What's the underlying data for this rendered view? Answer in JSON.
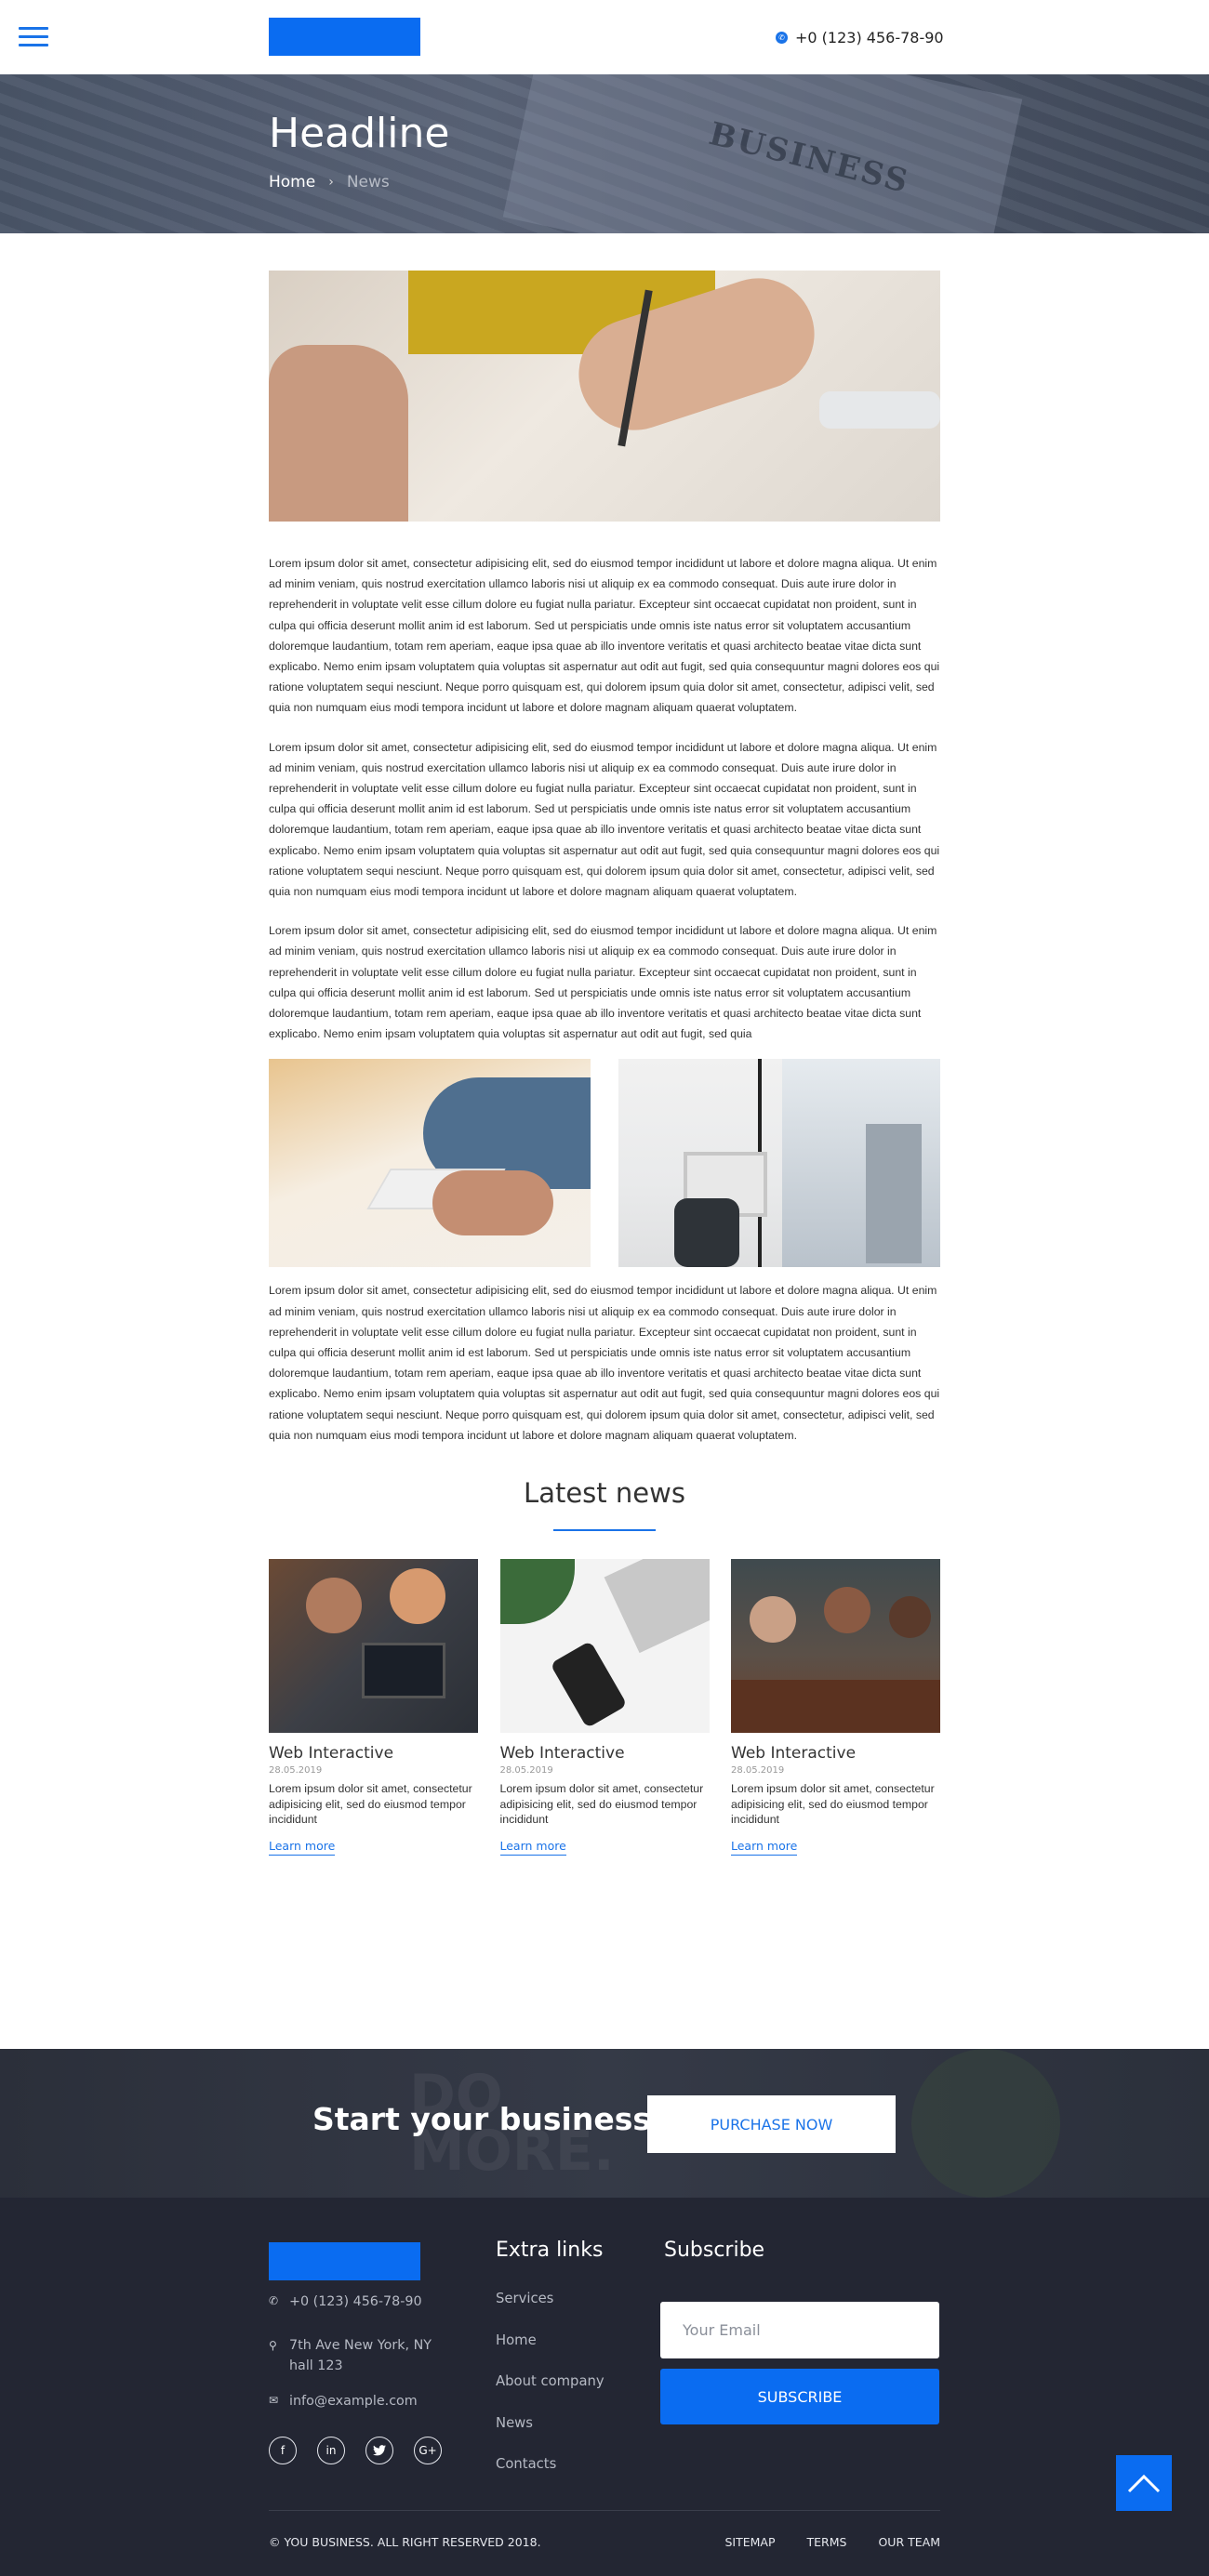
{
  "header": {
    "phone": "+0 (123) 456-78-90"
  },
  "hero": {
    "title": "Headline",
    "breadcrumb": {
      "home": "Home",
      "separator": "›",
      "current": "News"
    }
  },
  "article": {
    "paragraphs": [
      "Lorem ipsum dolor sit amet, consectetur adipisicing elit, sed do eiusmod tempor incididunt ut labore et dolore magna aliqua. Ut enim ad minim veniam, quis nostrud exercitation ullamco laboris nisi ut aliquip ex ea commodo consequat. Duis aute irure dolor in reprehenderit in voluptate velit esse cillum dolore eu fugiat nulla pariatur. Excepteur sint occaecat cupidatat non proident, sunt in culpa qui officia deserunt mollit anim id est laborum. Sed ut perspiciatis unde omnis iste natus error sit voluptatem accusantium doloremque laudantium, totam rem aperiam, eaque ipsa quae ab illo inventore veritatis et quasi architecto beatae vitae dicta sunt explicabo. Nemo enim ipsam voluptatem quia voluptas sit aspernatur aut odit aut fugit, sed quia consequuntur magni dolores eos qui ratione voluptatem sequi nesciunt. Neque porro quisquam est, qui dolorem ipsum quia dolor sit amet, consectetur, adipisci velit, sed quia non numquam eius modi tempora incidunt ut labore et dolore magnam aliquam quaerat voluptatem.",
      "Lorem ipsum dolor sit amet, consectetur adipisicing elit, sed do eiusmod tempor incididunt ut labore et dolore magna aliqua. Ut enim ad minim veniam, quis nostrud exercitation ullamco laboris nisi ut aliquip ex ea commodo consequat. Duis aute irure dolor in reprehenderit in voluptate velit esse cillum dolore eu fugiat nulla pariatur. Excepteur sint occaecat cupidatat non proident, sunt in culpa qui officia deserunt mollit anim id est laborum. Sed ut perspiciatis unde omnis iste natus error sit voluptatem accusantium doloremque laudantium, totam rem aperiam, eaque ipsa quae ab illo inventore veritatis et quasi architecto beatae vitae dicta sunt explicabo. Nemo enim ipsam voluptatem quia voluptas sit aspernatur aut odit aut fugit, sed quia consequuntur magni dolores eos qui ratione voluptatem sequi nesciunt. Neque porro quisquam est, qui dolorem ipsum quia dolor sit amet, consectetur, adipisci velit, sed quia non numquam eius modi tempora incidunt ut labore et dolore magnam aliquam quaerat voluptatem.",
      "Lorem ipsum dolor sit amet, consectetur adipisicing elit, sed do eiusmod tempor incididunt ut labore et dolore magna aliqua. Ut enim ad minim veniam, quis nostrud exercitation ullamco laboris nisi ut aliquip ex ea commodo consequat. Duis aute irure dolor in reprehenderit in voluptate velit esse cillum dolore eu fugiat nulla pariatur. Excepteur sint occaecat cupidatat non proident, sunt in culpa qui officia deserunt mollit anim id est laborum. Sed ut perspiciatis unde omnis iste natus error sit voluptatem accusantium doloremque laudantium, totam rem aperiam, eaque ipsa quae ab illo inventore veritatis et quasi architecto beatae vitae dicta sunt explicabo. Nemo enim ipsam voluptatem quia voluptas sit aspernatur aut odit aut fugit, sed quia",
      "Lorem ipsum dolor sit amet, consectetur adipisicing elit, sed do eiusmod tempor incididunt ut labore et dolore magna aliqua. Ut enim ad minim veniam, quis nostrud exercitation ullamco laboris nisi ut aliquip ex ea commodo consequat. Duis aute irure dolor in reprehenderit in voluptate velit esse cillum dolore eu fugiat nulla pariatur. Excepteur sint occaecat cupidatat non proident, sunt in culpa qui officia deserunt mollit anim id est laborum. Sed ut perspiciatis unde omnis iste natus error sit voluptatem accusantium doloremque laudantium, totam rem aperiam, eaque ipsa quae ab illo inventore veritatis et quasi architecto beatae vitae dicta sunt explicabo. Nemo enim ipsam voluptatem quia voluptas sit aspernatur aut odit aut fugit, sed quia consequuntur magni dolores eos qui ratione voluptatem sequi nesciunt. Neque porro quisquam est, qui dolorem ipsum quia dolor sit amet, consectetur, adipisci velit, sed quia non numquam eius modi tempora incidunt ut labore et dolore magnam aliquam quaerat voluptatem."
    ]
  },
  "latest_news": {
    "title": "Latest news",
    "items": [
      {
        "title": "Web Interactive",
        "date": "28.05.2019",
        "text": "Lorem ipsum dolor sit amet, consectetur adipisicing elit, sed do eiusmod tempor incididunt",
        "link": "Learn more"
      },
      {
        "title": "Web Interactive",
        "date": "28.05.2019",
        "text": "Lorem ipsum dolor sit amet, consectetur adipisicing elit, sed do eiusmod tempor incididunt",
        "link": "Learn more"
      },
      {
        "title": "Web Interactive",
        "date": "28.05.2019",
        "text": "Lorem ipsum dolor sit amet, consectetur adipisicing elit, sed do eiusmod tempor incididunt",
        "link": "Learn more"
      }
    ]
  },
  "cta": {
    "title": "Start your business",
    "button": "PURCHASE NOW"
  },
  "footer": {
    "phone": "+0 (123) 456-78-90",
    "address": "7th Ave New York, NY hall 123",
    "email": "info@example.com",
    "socials": [
      "facebook-icon",
      "linkedin-icon",
      "twitter-icon",
      "google-plus-icon"
    ],
    "extra_links_title": "Extra links",
    "extra_links": [
      "Services",
      "Home",
      "About company",
      "News",
      "Contacts"
    ],
    "subscribe_title": "Subscribe",
    "email_placeholder": "Your Email",
    "subscribe_button": "SUBSCRIBE",
    "copyright": "© YOU BUSINESS. ALL RIGHT RESERVED 2018.",
    "bottom_links": [
      "SITEMAP",
      "TERMS",
      "OUR TEAM"
    ]
  },
  "colors": {
    "accent": "#0a6cf1",
    "footer_bg": "#232633"
  }
}
